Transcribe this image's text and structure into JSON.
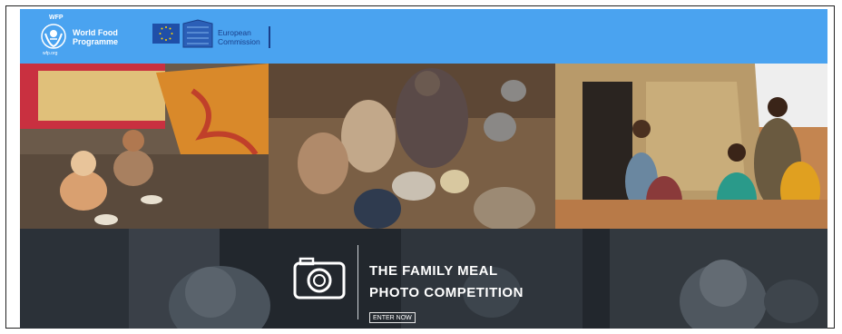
{
  "header": {
    "wfp_top_text": "WFP",
    "wfp_name": "World Food\nProgramme",
    "wfp_url": "wfp.org",
    "ec_name": "European\nCommission",
    "background_color": "#4aa3f0"
  },
  "photos": [
    {
      "name": "children-eating-on-floor-photo"
    },
    {
      "name": "family-sharing-meal-photo"
    },
    {
      "name": "family-outside-hut-photo"
    }
  ],
  "competition": {
    "title_line_1": "THE FAMILY MEAL",
    "title_line_2": "PHOTO COMPETITION",
    "enter_label": "ENTER NOW",
    "icon": "camera-icon"
  }
}
